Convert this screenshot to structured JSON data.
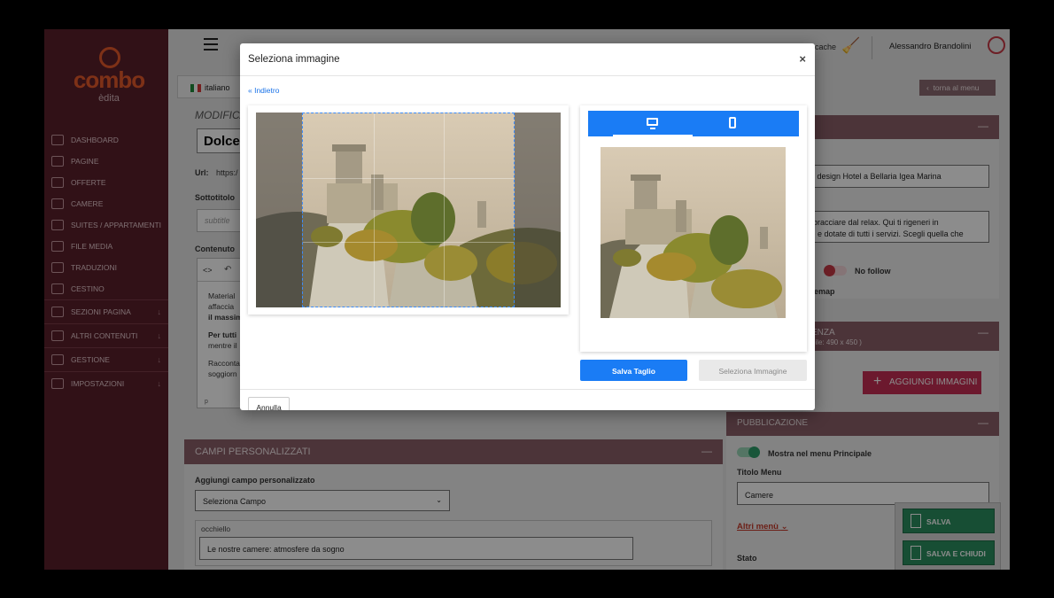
{
  "sidebar": {
    "logo_text": "combo",
    "logo_sub": "èdita",
    "items": [
      {
        "label": "DASHBOARD",
        "icon": "chart-icon"
      },
      {
        "label": "PAGINE",
        "icon": "page-icon"
      },
      {
        "label": "OFFERTE",
        "icon": "tag-icon"
      },
      {
        "label": "CAMERE",
        "icon": "bed-icon"
      },
      {
        "label": "SUITES / APPARTAMENTI",
        "icon": "diamond-icon"
      },
      {
        "label": "FILE MEDIA",
        "icon": "cloud-icon"
      },
      {
        "label": "TRADUZIONI",
        "icon": "translate-icon"
      },
      {
        "label": "CESTINO",
        "icon": "trash-icon"
      },
      {
        "label": "SEZIONI PAGINA",
        "icon": "code-icon",
        "group": true
      },
      {
        "label": "ALTRI CONTENUTI",
        "icon": "grid-icon",
        "group": true
      },
      {
        "label": "GESTIONE",
        "icon": "gear-icon",
        "group": true
      },
      {
        "label": "IMPOSTAZIONI",
        "icon": "settings-icon",
        "group": true
      }
    ]
  },
  "topbar": {
    "cache_label": "cache",
    "user_name": "Alessandro Brandolini"
  },
  "main": {
    "lang_tab": "italiano",
    "modifica": "MODIFICA",
    "title_value": "Dolce",
    "url_label": "Url:",
    "url_value": "https:/",
    "sottotitolo_label": "Sottotitolo",
    "subtitle_placeholder": "subtitle",
    "contenuto_label": "Contenuto",
    "editor_lines": [
      "Material",
      "affaccia",
      "il massim",
      "Per tutti",
      "mentre il",
      "Racconta",
      "soggiorn"
    ],
    "editor_footer": "p"
  },
  "campi": {
    "header": "CAMPI PERSONALIZZATI",
    "add_label": "Aggiungi campo personalizzato",
    "select_value": "Seleziona Campo",
    "occhiello_label": "occhiello",
    "occhiello_value": "Le nostre camere: atmosfere da sogno"
  },
  "right": {
    "torna_label": "torna al menu",
    "seo_title_value": "i e di design Hotel a Bellaria Igea Marina",
    "seo_desc_line1": "ti abbracciare dal relax. Qui ti rigeneri in",
    "seo_desc_line2": "nose e dotate di tutti i servizi. Scegli quella che",
    "nofollow_label": "No follow",
    "sitemap_label": "temap",
    "gallery_header": "ENZA",
    "gallery_sub": "bile: 490 x 450 )",
    "add_images_label": "AGGIUNGI IMMAGINI",
    "pub_header": "PUBBLICAZIONE",
    "show_menu_label": "Mostra nel menu Principale",
    "menu_title_label": "Titolo Menu",
    "menu_title_value": "Camere",
    "altri_menu_label": "Altri menù",
    "stato_label": "Stato",
    "save_label": "SALVA",
    "save_close_label": "SALVA E CHIUDI"
  },
  "modal": {
    "title": "Seleziona immagine",
    "close": "×",
    "back_link": "« Indietro",
    "crop_button": "Salva Taglio",
    "select_button": "Seleziona Immagine",
    "cancel_button": "Annulla"
  },
  "colors": {
    "sidebar": "#5a1f2b",
    "accent_orange": "#e65a2b",
    "panel_header": "#8a5f69",
    "primary_blue": "#1a7cf5",
    "save_green": "#2a8f5f",
    "pink": "#c52f55"
  }
}
